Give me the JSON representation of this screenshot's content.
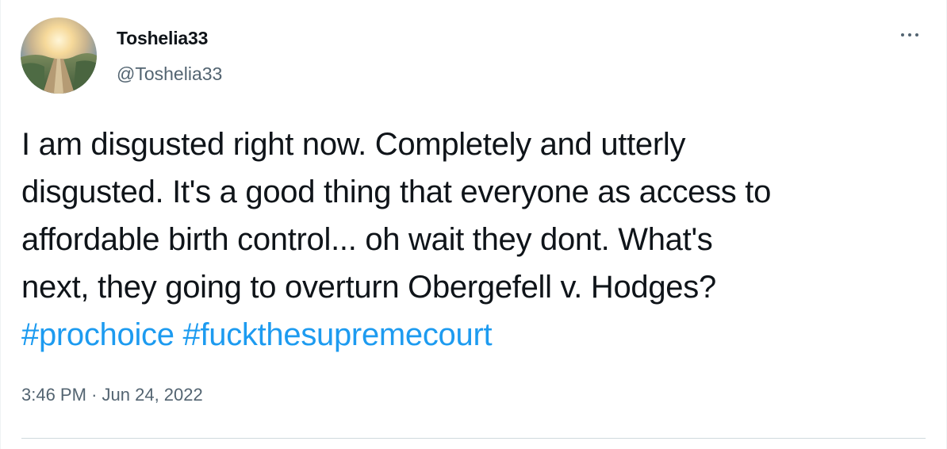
{
  "author": {
    "display_name": "Toshelia33",
    "handle": "@Toshelia33"
  },
  "more_menu": {
    "icon": "more-horizontal-icon"
  },
  "tweet": {
    "lines": [
      "I am disgusted right now. Completely and utterly",
      "disgusted. It's a good thing that everyone as access to",
      "affordable birth control... oh wait they dont. What's",
      "next, they going to overturn Obergefell v. Hodges?"
    ],
    "hashtags": [
      "#prochoice",
      "#fuckthesupremecourt"
    ]
  },
  "meta": {
    "time": "3:46 PM",
    "separator": "·",
    "date": "Jun 24, 2022"
  },
  "colors": {
    "text": "#0f1419",
    "secondary": "#536471",
    "link": "#1d9bf0",
    "divider": "#cfd9de"
  }
}
